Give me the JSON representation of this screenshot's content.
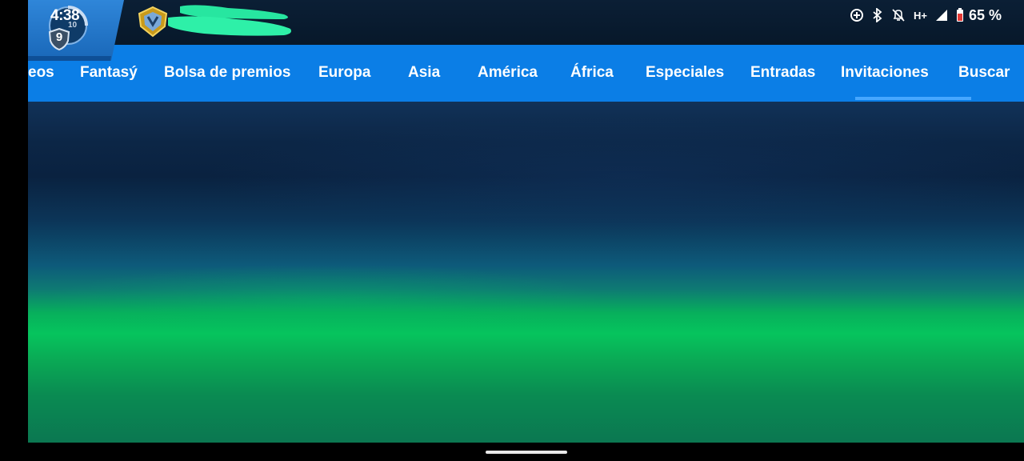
{
  "status_bar": {
    "time": "4:38",
    "network_type": "H+",
    "battery_percent": "65 %",
    "icons": [
      "data-saver-icon",
      "bluetooth-icon",
      "notifications-off-icon",
      "signal-icon",
      "battery-icon"
    ]
  },
  "player": {
    "level": "9",
    "next_level": "10",
    "rank_emblem": "rank-emblem-icon"
  },
  "nav": {
    "items": [
      {
        "label": "eos"
      },
      {
        "label": "Fantasý"
      },
      {
        "label": "Bolsa de premios"
      },
      {
        "label": "Europa"
      },
      {
        "label": "Asia"
      },
      {
        "label": "América"
      },
      {
        "label": "África"
      },
      {
        "label": "Especiales"
      },
      {
        "label": "Entradas"
      },
      {
        "label": "Invitaciones"
      },
      {
        "label": "Buscar"
      }
    ],
    "active": "Invitaciones"
  },
  "colors": {
    "nav_bar": "#0b7ee6",
    "top_bar": "#081a2e",
    "active_underline": "#46a7ff"
  }
}
